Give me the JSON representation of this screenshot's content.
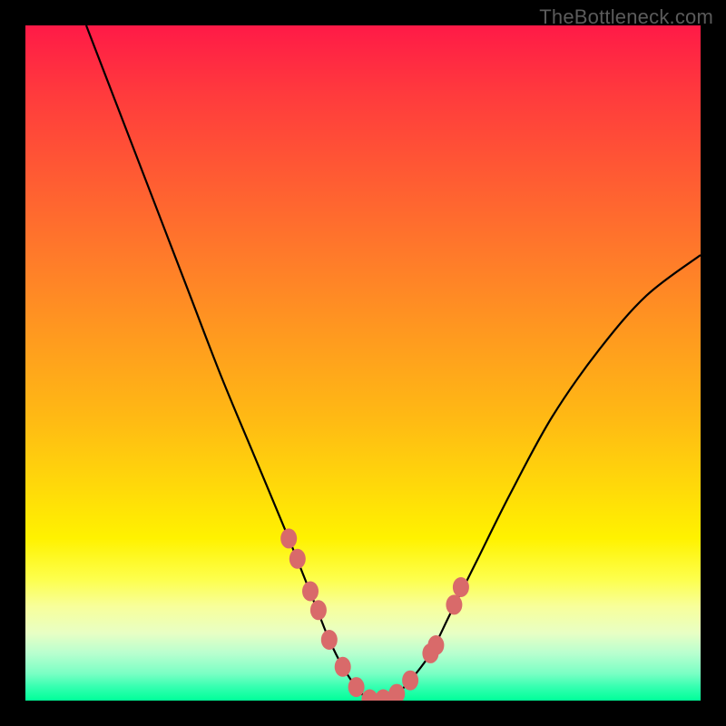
{
  "watermark": "TheBottleneck.com",
  "colors": {
    "frame": "#000000",
    "curve": "#000000",
    "marker_fill": "#d96a6a",
    "marker_stroke": "#c95a5a"
  },
  "chart_data": {
    "type": "line",
    "title": "",
    "xlabel": "",
    "ylabel": "",
    "xlim": [
      0,
      100
    ],
    "ylim": [
      0,
      100
    ],
    "note": "Axes are unlabeled; values estimated from pixel positions on a 0–100 normalized scale (y = 0 at bottom, 100 at top).",
    "series": [
      {
        "name": "curve",
        "x": [
          9,
          14,
          19,
          24,
          29,
          34,
          39,
          43,
          45,
          47,
          49,
          51,
          53,
          55,
          57,
          60,
          63,
          67,
          72,
          78,
          85,
          92,
          100
        ],
        "y": [
          100,
          87,
          74,
          61,
          48,
          36,
          24,
          14,
          9,
          5,
          2,
          0,
          0,
          1,
          3,
          7,
          13,
          21,
          31,
          42,
          52,
          60,
          66
        ]
      }
    ],
    "markers": {
      "name": "highlight-dots",
      "x": [
        39.0,
        40.3,
        42.2,
        43.4,
        45.0,
        47.0,
        49.0,
        51.0,
        53.0,
        55.0,
        57.0,
        60.0,
        60.8,
        63.5,
        64.5
      ],
      "y": [
        24.0,
        21.0,
        16.2,
        13.4,
        9.0,
        5.0,
        2.0,
        0.2,
        0.2,
        1.0,
        3.0,
        7.0,
        8.2,
        14.2,
        16.8
      ]
    }
  }
}
